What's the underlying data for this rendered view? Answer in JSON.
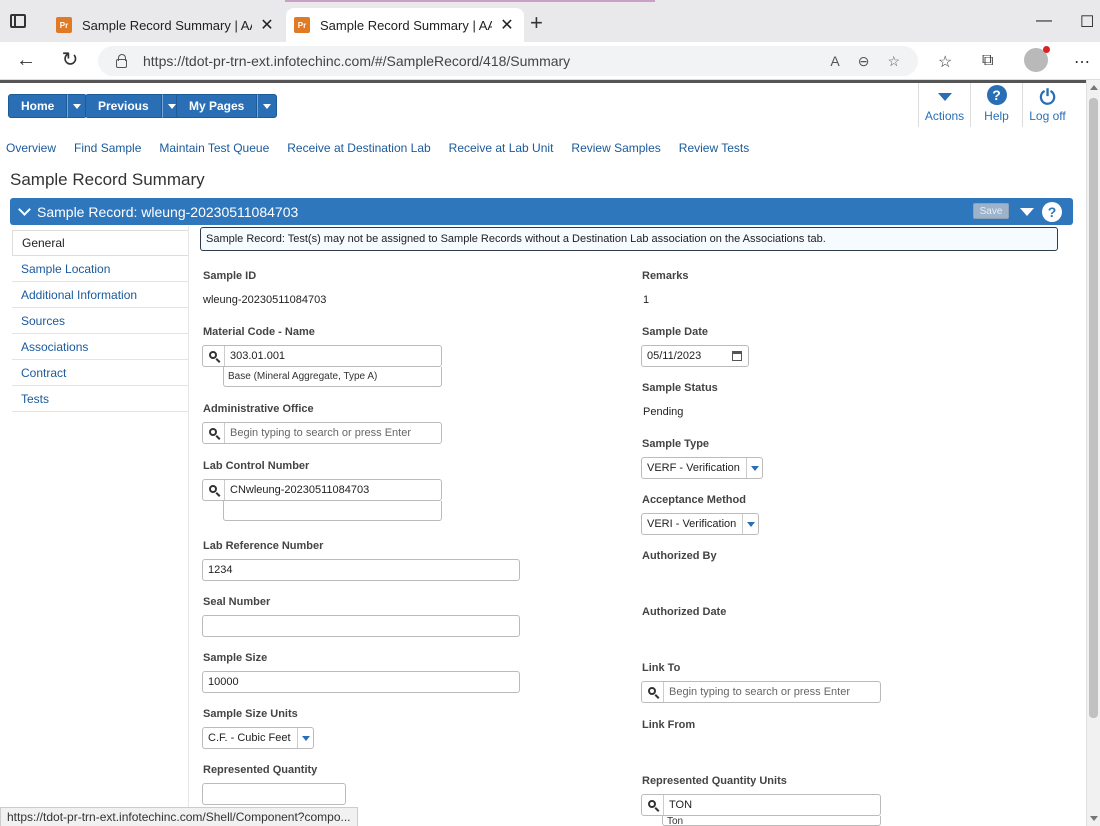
{
  "browser": {
    "tabs": [
      {
        "title": "Sample Record Summary | AASH",
        "favicon": "Pr"
      },
      {
        "title": "Sample Record Summary | AASH",
        "favicon": "Pr"
      }
    ],
    "url": "https://tdot-pr-trn-ext.infotechinc.com/#/SampleRecord/418/Summary",
    "status_url": "https://tdot-pr-trn-ext.infotechinc.com/Shell/Component?compo..."
  },
  "toolbar": {
    "home_label": "Home",
    "previous_label": "Previous",
    "mypages_label": "My Pages",
    "actions_label": "Actions",
    "help_label": "Help",
    "logoff_label": "Log off"
  },
  "quick_links": [
    "Overview",
    "Find Sample",
    "Maintain Test Queue",
    "Receive at Destination Lab",
    "Receive at Lab Unit",
    "Review Samples",
    "Review Tests"
  ],
  "page_title": "Sample Record Summary",
  "section": {
    "title": "Sample Record: wleung-20230511084703",
    "save_label": "Save"
  },
  "side_tabs": [
    "General",
    "Sample Location",
    "Additional Information",
    "Sources",
    "Associations",
    "Contract",
    "Tests"
  ],
  "alert": "Sample Record: Test(s) may not be assigned to Sample Records without a Destination Lab association on the Associations tab.",
  "left_fields": {
    "sample_id_label": "Sample ID",
    "sample_id_value": "wleung-20230511084703",
    "material_label": "Material Code - Name",
    "material_code": "303.01.001",
    "material_name": "Base (Mineral Aggregate, Type A)",
    "admin_office_label": "Administrative Office",
    "admin_office_placeholder": "Begin typing to search or press Enter",
    "lab_control_label": "Lab Control Number",
    "lab_control_value": "CNwleung-20230511084703",
    "lab_ref_label": "Lab Reference Number",
    "lab_ref_value": "1234",
    "seal_label": "Seal Number",
    "seal_value": "",
    "sample_size_label": "Sample Size",
    "sample_size_value": "10000",
    "size_units_label": "Sample Size Units",
    "size_units_value": "C.F. - Cubic Feet",
    "rep_qty_label": "Represented Quantity",
    "rep_qty_value": ""
  },
  "right_fields": {
    "remarks_label": "Remarks",
    "remarks_value": "1",
    "sample_date_label": "Sample Date",
    "sample_date_value": "05/11/2023",
    "status_label": "Sample Status",
    "status_value": "Pending",
    "type_label": "Sample Type",
    "type_value": "VERF - Verification",
    "acceptance_label": "Acceptance Method",
    "acceptance_value": "VERI - Verification",
    "authorized_by_label": "Authorized By",
    "authorized_date_label": "Authorized Date",
    "link_to_label": "Link To",
    "link_to_placeholder": "Begin typing to search or press Enter",
    "link_from_label": "Link From",
    "rep_qty_units_label": "Represented Quantity Units",
    "rep_qty_units_value": "TON",
    "rep_qty_units_sub": "Ton"
  }
}
